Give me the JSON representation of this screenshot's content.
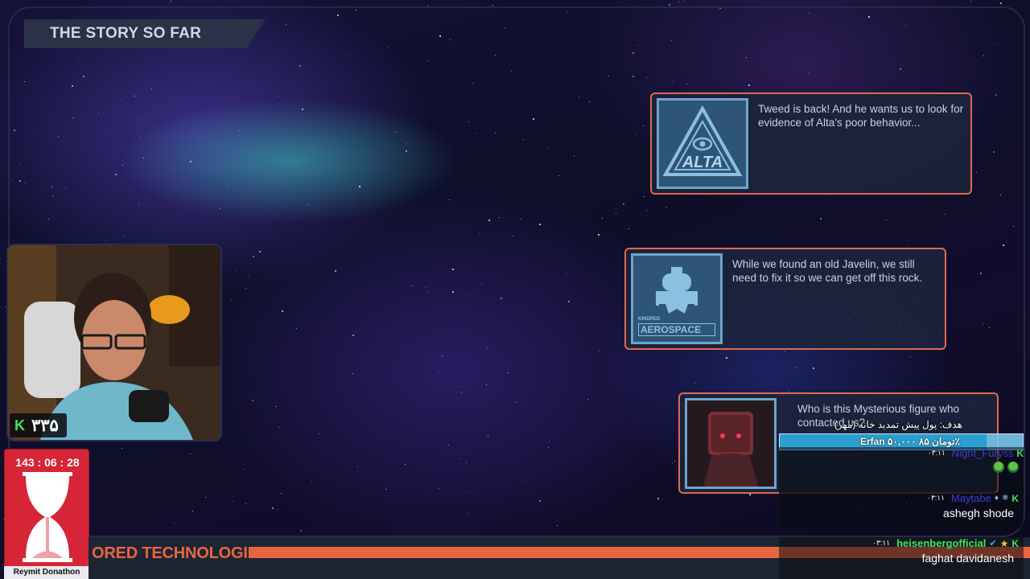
{
  "overlay": {
    "story_title": "THE STORY SO FAR",
    "brand_text": "ORED TECHNOLOGIES"
  },
  "cards": [
    {
      "id": "alta",
      "thumb_label": "ALTA",
      "text": "Tweed is back! And he wants us to look for evidence of Alta's poor behavior..."
    },
    {
      "id": "aero",
      "thumb_label": "AEROSPACE",
      "thumb_small": "KINDRED",
      "text": "While we found an old Javelin, we still need to fix it so we can get off this rock."
    },
    {
      "id": "mystery",
      "text": "Who is this Mysterious figure who contacted us?"
    }
  ],
  "stream": {
    "follower_badge": "K",
    "follower_count": "۳۳۵",
    "timer": "143 : 06 : 28",
    "timer_label": "Reymit Donathon"
  },
  "donation": {
    "goal_text": "هدف: پول پیش تمدید خانه (مهر)",
    "goal_info": "Erfan ۵۰,۰۰۰ تومان ۸۵٪",
    "goal_progress": 0.85
  },
  "chat": [
    {
      "user": "Night_Furyss",
      "user_color": "#3a3fd6",
      "time": "۰۳:۱۱",
      "text": "",
      "badges": [
        "K"
      ]
    },
    {
      "user": "Maytabe",
      "user_color": "#3a3fd6",
      "time": "۰۳:۱۱",
      "text": "ashegh shode",
      "badges": [
        "diamond",
        "heart",
        "K"
      ]
    },
    {
      "user": "heisenbergofficial",
      "user_color": "#42e35e",
      "time": "۰۳:۱۱",
      "text": "faghat davidanesh",
      "badges": [
        "verified",
        "star",
        "K"
      ]
    }
  ],
  "colors": {
    "accent_orange": "#e8663f",
    "card_border": "#e0694e",
    "timer_red": "#d62536",
    "kick_green": "#42e35e"
  }
}
